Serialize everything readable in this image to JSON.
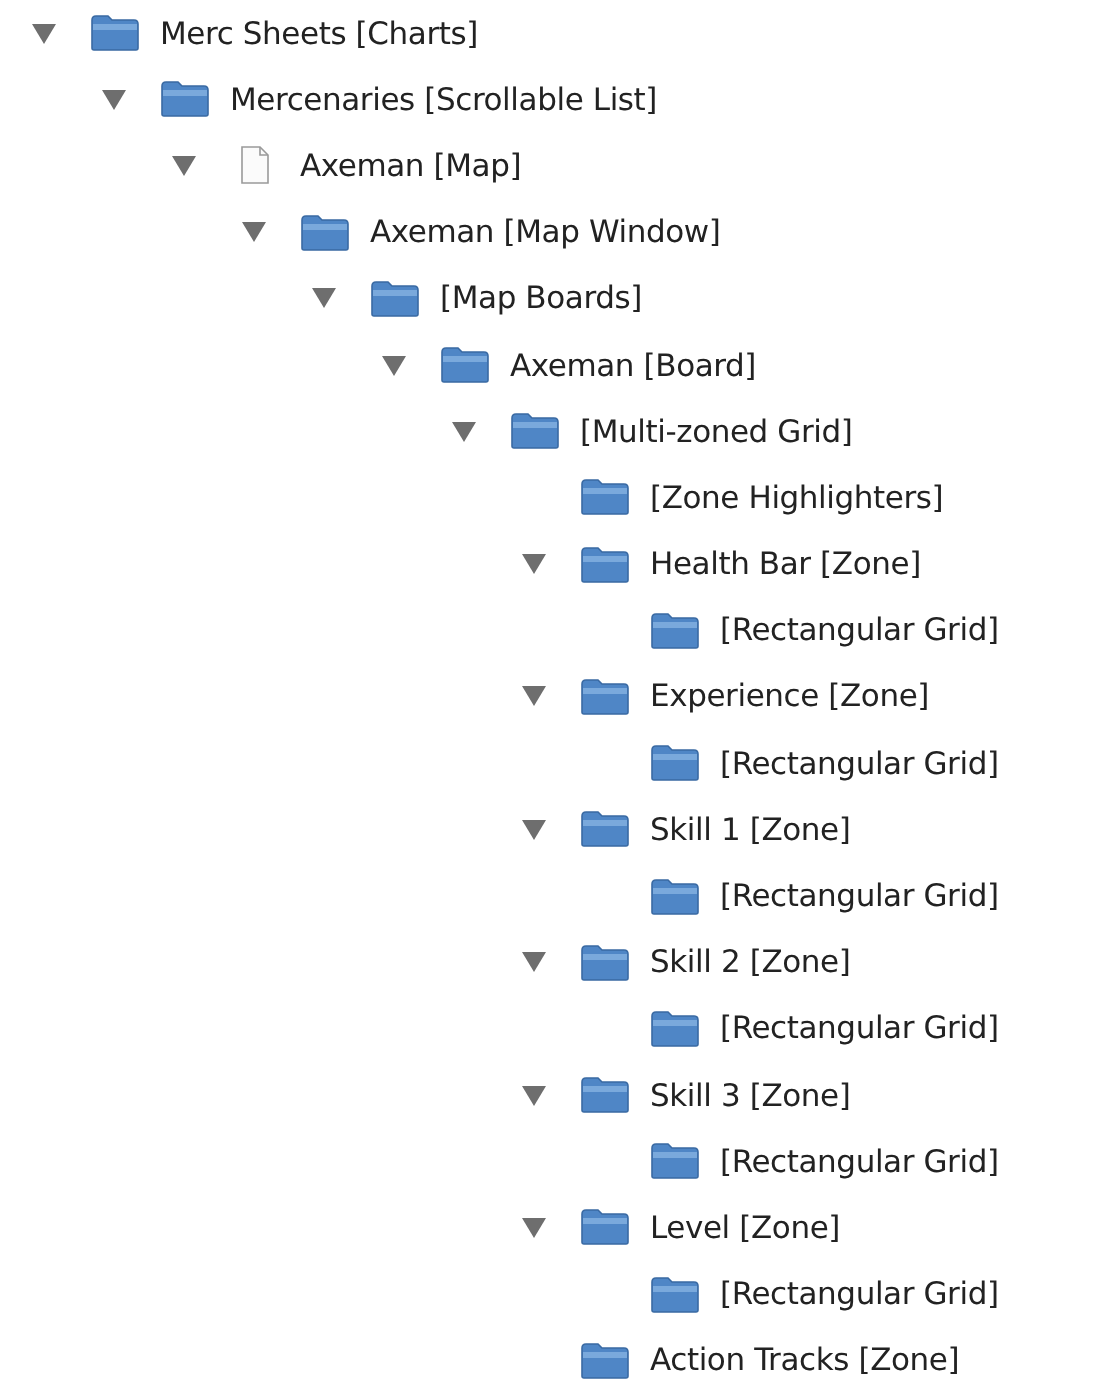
{
  "tree": [
    {
      "label": "Merc Sheets [Charts]",
      "kind": "folder",
      "expanded": true,
      "children": [
        {
          "label": "Mercenaries [Scrollable List]",
          "kind": "folder",
          "expanded": true,
          "children": [
            {
              "label": "Axeman [Map]",
              "kind": "file",
              "expanded": true,
              "children": [
                {
                  "label": "Axeman [Map Window]",
                  "kind": "folder",
                  "expanded": true,
                  "children": [
                    {
                      "label": "[Map Boards]",
                      "kind": "folder",
                      "expanded": true,
                      "children": [
                        {
                          "label": "Axeman [Board]",
                          "kind": "folder",
                          "expanded": true,
                          "children": [
                            {
                              "label": "[Multi-zoned Grid]",
                              "kind": "folder",
                              "expanded": true,
                              "children": [
                                {
                                  "label": "[Zone Highlighters]",
                                  "kind": "folder"
                                },
                                {
                                  "label": "Health Bar [Zone]",
                                  "kind": "folder",
                                  "expanded": true,
                                  "children": [
                                    {
                                      "label": "[Rectangular Grid]",
                                      "kind": "folder"
                                    }
                                  ]
                                },
                                {
                                  "label": "Experience [Zone]",
                                  "kind": "folder",
                                  "expanded": true,
                                  "children": [
                                    {
                                      "label": "[Rectangular Grid]",
                                      "kind": "folder"
                                    }
                                  ]
                                },
                                {
                                  "label": "Skill 1 [Zone]",
                                  "kind": "folder",
                                  "expanded": true,
                                  "children": [
                                    {
                                      "label": "[Rectangular Grid]",
                                      "kind": "folder"
                                    }
                                  ]
                                },
                                {
                                  "label": "Skill 2 [Zone]",
                                  "kind": "folder",
                                  "expanded": true,
                                  "children": [
                                    {
                                      "label": "[Rectangular Grid]",
                                      "kind": "folder"
                                    }
                                  ]
                                },
                                {
                                  "label": "Skill 3 [Zone]",
                                  "kind": "folder",
                                  "expanded": true,
                                  "children": [
                                    {
                                      "label": "[Rectangular Grid]",
                                      "kind": "folder"
                                    }
                                  ]
                                },
                                {
                                  "label": "Level [Zone]",
                                  "kind": "folder",
                                  "expanded": true,
                                  "children": [
                                    {
                                      "label": "[Rectangular Grid]",
                                      "kind": "folder"
                                    }
                                  ]
                                },
                                {
                                  "label": "Action Tracks [Zone]",
                                  "kind": "folder"
                                }
                              ]
                            }
                          ]
                        }
                      ]
                    }
                  ]
                }
              ]
            }
          ]
        }
      ]
    }
  ]
}
